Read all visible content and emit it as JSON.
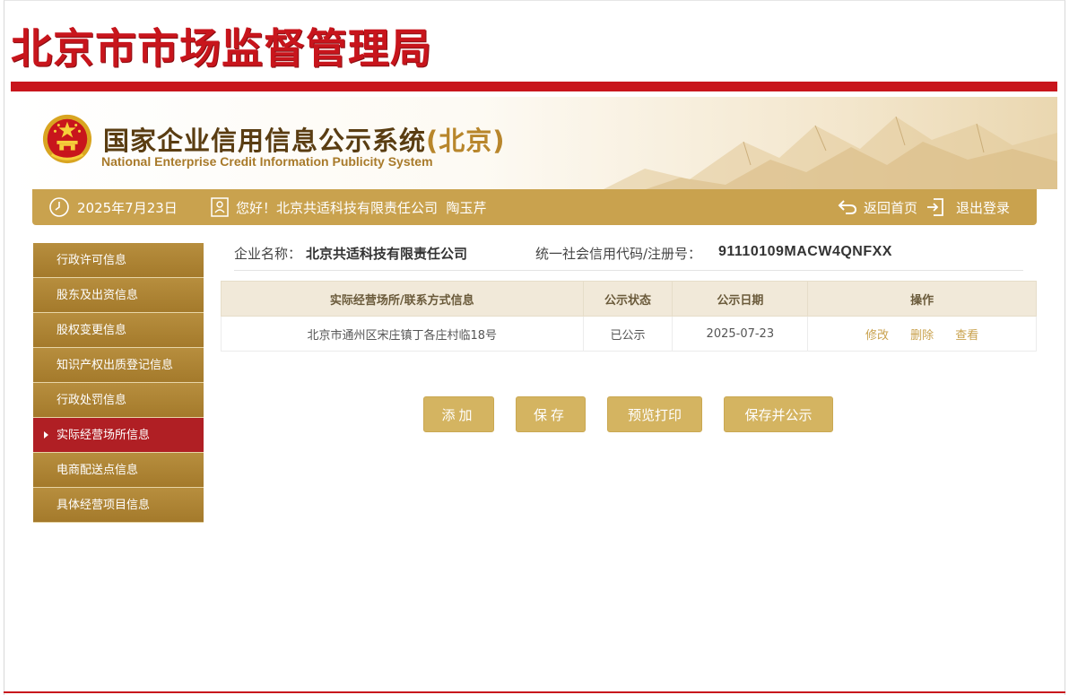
{
  "header": {
    "bureau_title": "北京市市场监督管理局"
  },
  "banner": {
    "title_cn": "国家企业信用信息公示系统",
    "title_region": "(北京)",
    "title_en": "National Enterprise Credit Information Publicity System"
  },
  "info_bar": {
    "date": "2025年7月23日",
    "greeting": "您好！北京共适科技有限责任公司  陶玉芹",
    "home_label": "返回首页",
    "logout_label": "退出登录"
  },
  "sidebar": {
    "items": [
      {
        "label": "行政许可信息",
        "active": false
      },
      {
        "label": "股东及出资信息",
        "active": false
      },
      {
        "label": "股权变更信息",
        "active": false
      },
      {
        "label": "知识产权出质登记信息",
        "active": false
      },
      {
        "label": "行政处罚信息",
        "active": false
      },
      {
        "label": "实际经营场所信息",
        "active": true
      },
      {
        "label": "电商配送点信息",
        "active": false
      },
      {
        "label": "具体经营项目信息",
        "active": false
      }
    ]
  },
  "company": {
    "name_label": "企业名称：",
    "name_value": "北京共适科技有限责任公司",
    "code_label": "统一社会信用代码/注册号：",
    "code_value": "91110109MACW4QNFXX"
  },
  "table": {
    "headers": [
      "实际经营场所/联系方式信息",
      "公示状态",
      "公示日期",
      "操作"
    ],
    "rows": [
      {
        "address": "北京市通州区宋庄镇丁各庄村临18号",
        "status": "已公示",
        "date": "2025-07-23",
        "ops": [
          "修改",
          "删除",
          "查看"
        ]
      }
    ]
  },
  "buttons": {
    "add": "添加",
    "save": "保存",
    "print": "预览打印",
    "publish": "保存并公示"
  },
  "colors": {
    "brand_red": "#c8151c",
    "gold": "#c9a24e",
    "sidebar_active": "#b01f24"
  }
}
